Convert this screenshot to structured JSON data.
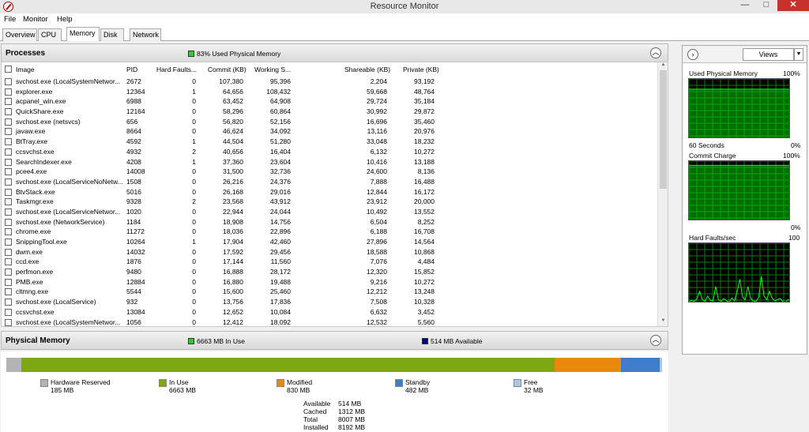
{
  "window": {
    "title": "Resource Monitor"
  },
  "menu": [
    "File",
    "Monitor",
    "Help"
  ],
  "tabs": [
    "Overview",
    "CPU",
    "Memory",
    "Disk",
    "Network"
  ],
  "processes": {
    "title": "Processes",
    "legend": "83% Used Physical Memory",
    "legend_color": "#2ecc2e",
    "columns": [
      "Image",
      "PID",
      "Hard Faults...",
      "Commit (KB)",
      "Working S...",
      "Shareable (KB)",
      "Private (KB)"
    ],
    "rows": [
      [
        "svchost.exe (LocalSystemNetwor...",
        "2672",
        "0",
        "107,380",
        "95,396",
        "2,204",
        "93,192"
      ],
      [
        "explorer.exe",
        "12364",
        "1",
        "64,656",
        "108,432",
        "59,668",
        "48,764"
      ],
      [
        "acpanel_win.exe",
        "6988",
        "0",
        "63,452",
        "64,908",
        "29,724",
        "35,184"
      ],
      [
        "QuickShare.exe",
        "12164",
        "0",
        "58,296",
        "60,864",
        "30,992",
        "29,872"
      ],
      [
        "svchost.exe (netsvcs)",
        "656",
        "0",
        "56,820",
        "52,156",
        "16,696",
        "35,460"
      ],
      [
        "javaw.exe",
        "8664",
        "0",
        "46,624",
        "34,092",
        "13,116",
        "20,976"
      ],
      [
        "BtTray.exe",
        "4592",
        "1",
        "44,504",
        "51,280",
        "33,048",
        "18,232"
      ],
      [
        "ccsvchst.exe",
        "4932",
        "2",
        "40,656",
        "16,404",
        "6,132",
        "10,272"
      ],
      [
        "SearchIndexer.exe",
        "4208",
        "1",
        "37,360",
        "23,604",
        "10,416",
        "13,188"
      ],
      [
        "pcee4.exe",
        "14008",
        "0",
        "31,500",
        "32,736",
        "24,600",
        "8,136"
      ],
      [
        "svchost.exe (LocalServiceNoNetw...",
        "1508",
        "0",
        "26,216",
        "24,376",
        "7,888",
        "16,488"
      ],
      [
        "BtvStack.exe",
        "5016",
        "0",
        "26,168",
        "29,016",
        "12,844",
        "16,172"
      ],
      [
        "Taskmgr.exe",
        "9328",
        "2",
        "23,568",
        "43,912",
        "23,912",
        "20,000"
      ],
      [
        "svchost.exe (LocalServiceNetwor...",
        "1020",
        "0",
        "22,944",
        "24,044",
        "10,492",
        "13,552"
      ],
      [
        "svchost.exe (NetworkService)",
        "1184",
        "0",
        "18,908",
        "14,756",
        "6,504",
        "8,252"
      ],
      [
        "chrome.exe",
        "11272",
        "0",
        "18,036",
        "22,896",
        "6,188",
        "16,708"
      ],
      [
        "SnippingTool.exe",
        "10264",
        "1",
        "17,904",
        "42,460",
        "27,896",
        "14,564"
      ],
      [
        "dwm.exe",
        "14032",
        "0",
        "17,592",
        "29,456",
        "18,588",
        "10,868"
      ],
      [
        "ccd.exe",
        "1876",
        "0",
        "17,144",
        "11,560",
        "7,076",
        "4,484"
      ],
      [
        "perfmon.exe",
        "9480",
        "0",
        "16,888",
        "28,172",
        "12,320",
        "15,852"
      ],
      [
        "PMB.exe",
        "12884",
        "0",
        "16,880",
        "19,488",
        "9,216",
        "10,272"
      ],
      [
        "cltmng.exe",
        "5544",
        "0",
        "15,600",
        "25,460",
        "12,212",
        "13,248"
      ],
      [
        "svchost.exe (LocalService)",
        "932",
        "0",
        "13,756",
        "17,836",
        "7,508",
        "10,328"
      ],
      [
        "ccsvchst.exe",
        "13084",
        "0",
        "12,652",
        "10,084",
        "6,632",
        "3,452"
      ],
      [
        "svchost.exe (LocalSystemNetwor...",
        "1056",
        "0",
        "12,412",
        "18,092",
        "12,532",
        "5,560"
      ]
    ]
  },
  "physical_memory": {
    "title": "Physical Memory",
    "in_use_legend": "6663 MB In Use",
    "available_legend": "514 MB Available",
    "segments": [
      {
        "label": "Hardware Reserved",
        "value": "185 MB",
        "mb": 185,
        "color": "#b4b4b4"
      },
      {
        "label": "In Use",
        "value": "6663 MB",
        "mb": 6663,
        "color": "#7ea813"
      },
      {
        "label": "Modified",
        "value": "830 MB",
        "mb": 830,
        "color": "#e8890c"
      },
      {
        "label": "Standby",
        "value": "482 MB",
        "mb": 482,
        "color": "#3f7cc9"
      },
      {
        "label": "Free",
        "value": "32 MB",
        "mb": 32,
        "color": "#a9c8ea"
      }
    ],
    "summary": [
      {
        "label": "Available",
        "value": "514 MB"
      },
      {
        "label": "Cached",
        "value": "1312 MB"
      },
      {
        "label": "Total",
        "value": "8007 MB"
      },
      {
        "label": "Installed",
        "value": "8192 MB"
      }
    ]
  },
  "side_panel": {
    "views_label": "Views",
    "graphs": [
      {
        "title": "Used Physical Memory",
        "max": "100%",
        "left_caption": "60 Seconds",
        "right_caption": "0%"
      },
      {
        "title": "Commit Charge",
        "max": "100%",
        "left_caption": "",
        "right_caption": "0%"
      },
      {
        "title": "Hard Faults/sec",
        "max": "100",
        "left_caption": "",
        "right_caption": ""
      }
    ]
  },
  "colors": {
    "graph_bg": "#000000",
    "graph_grid": "#008000",
    "graph_line": "#00ff00"
  }
}
